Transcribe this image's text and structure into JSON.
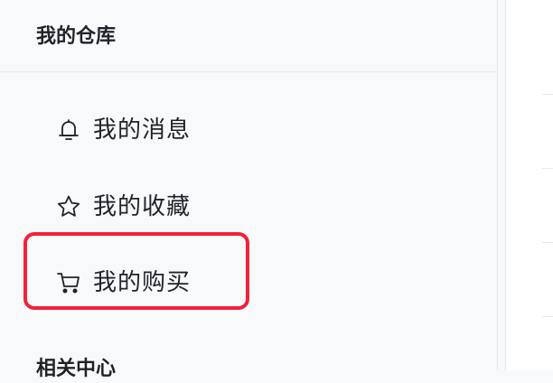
{
  "sidebar": {
    "section_title": "我的仓库",
    "items": [
      {
        "label": "我的消息",
        "icon": "bell-icon"
      },
      {
        "label": "我的收藏",
        "icon": "star-icon"
      },
      {
        "label": "我的购买",
        "icon": "cart-icon"
      }
    ],
    "section2_title": "相关中心"
  },
  "colors": {
    "highlight": "#f2213a",
    "text": "#1f2329",
    "background": "#f8f9fb"
  }
}
